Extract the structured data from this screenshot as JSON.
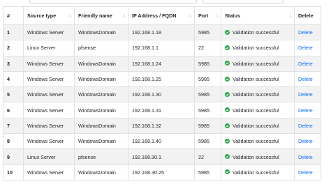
{
  "colors": {
    "success": "#28a745",
    "link": "#0d6efd",
    "stripe": "#f2f2f2",
    "border": "#dee2e6"
  },
  "table": {
    "headers": {
      "num": "#",
      "source_type": "Source type",
      "friendly_name": "Friendly name",
      "ip": "IP Address / FQDN",
      "port": "Port",
      "status": "Status",
      "delete": "Delete"
    },
    "rows": [
      {
        "num": "1",
        "source_type": "Windows Server",
        "friendly_name": "WindowsDomain",
        "ip": "192.168.1.18",
        "port": "5985",
        "status": "Validation successful",
        "action": "Delete"
      },
      {
        "num": "2",
        "source_type": "Linux Server",
        "friendly_name": "pfsense",
        "ip": "192.168.1.1",
        "port": "22",
        "status": "Validation successful",
        "action": "Delete"
      },
      {
        "num": "3",
        "source_type": "Windows Server",
        "friendly_name": "WindowsDomain",
        "ip": "192.168.1.24",
        "port": "5985",
        "status": "Validation successful",
        "action": "Delete"
      },
      {
        "num": "4",
        "source_type": "Windows Server",
        "friendly_name": "WindowsDomain",
        "ip": "192.168.1.25",
        "port": "5985",
        "status": "Validation successful",
        "action": "Delete"
      },
      {
        "num": "5",
        "source_type": "Windows Server",
        "friendly_name": "WindowsDomain",
        "ip": "192.168.1.30",
        "port": "5985",
        "status": "Validation successful",
        "action": "Delete"
      },
      {
        "num": "6",
        "source_type": "Windows Server",
        "friendly_name": "WindowsDomain",
        "ip": "192.168.1.31",
        "port": "5985",
        "status": "Validation successful",
        "action": "Delete"
      },
      {
        "num": "7",
        "source_type": "Windows Server",
        "friendly_name": "WindowsDomain",
        "ip": "192.168.1.32",
        "port": "5985",
        "status": "Validation successful",
        "action": "Delete"
      },
      {
        "num": "8",
        "source_type": "Windows Server",
        "friendly_name": "WindowsDomain",
        "ip": "192.168.1.40",
        "port": "5985",
        "status": "Validation successful",
        "action": "Delete"
      },
      {
        "num": "9",
        "source_type": "Linux Server",
        "friendly_name": "pfsense",
        "ip": "192.168.30.1",
        "port": "22",
        "status": "Validation successful",
        "action": "Delete"
      },
      {
        "num": "10",
        "source_type": "Windows Server",
        "friendly_name": "WindowsDomain",
        "ip": "192.168.30.25",
        "port": "5985",
        "status": "Validation successful",
        "action": "Delete"
      }
    ]
  }
}
